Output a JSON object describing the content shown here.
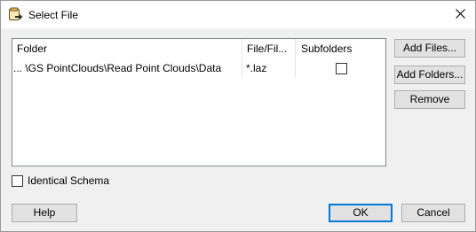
{
  "window": {
    "title": "Select File",
    "app_icon": "fme-document-icon",
    "close_icon": "close-icon"
  },
  "table": {
    "columns": [
      "Folder",
      "File/Fil...",
      "Subfolders"
    ],
    "rows": [
      {
        "folder": "... \\GS PointClouds\\Read Point Clouds\\Data",
        "file": "*.laz",
        "subfolders": false
      }
    ]
  },
  "buttons": {
    "add_files": "Add Files...",
    "add_folders": "Add Folders...",
    "remove": "Remove",
    "help": "Help",
    "ok": "OK",
    "cancel": "Cancel"
  },
  "identical_schema": {
    "label": "Identical Schema",
    "checked": false
  },
  "colors": {
    "focus": "#0078d7",
    "button_bg": "#e1e1e1",
    "dialog_bg": "#f0f0f0"
  }
}
